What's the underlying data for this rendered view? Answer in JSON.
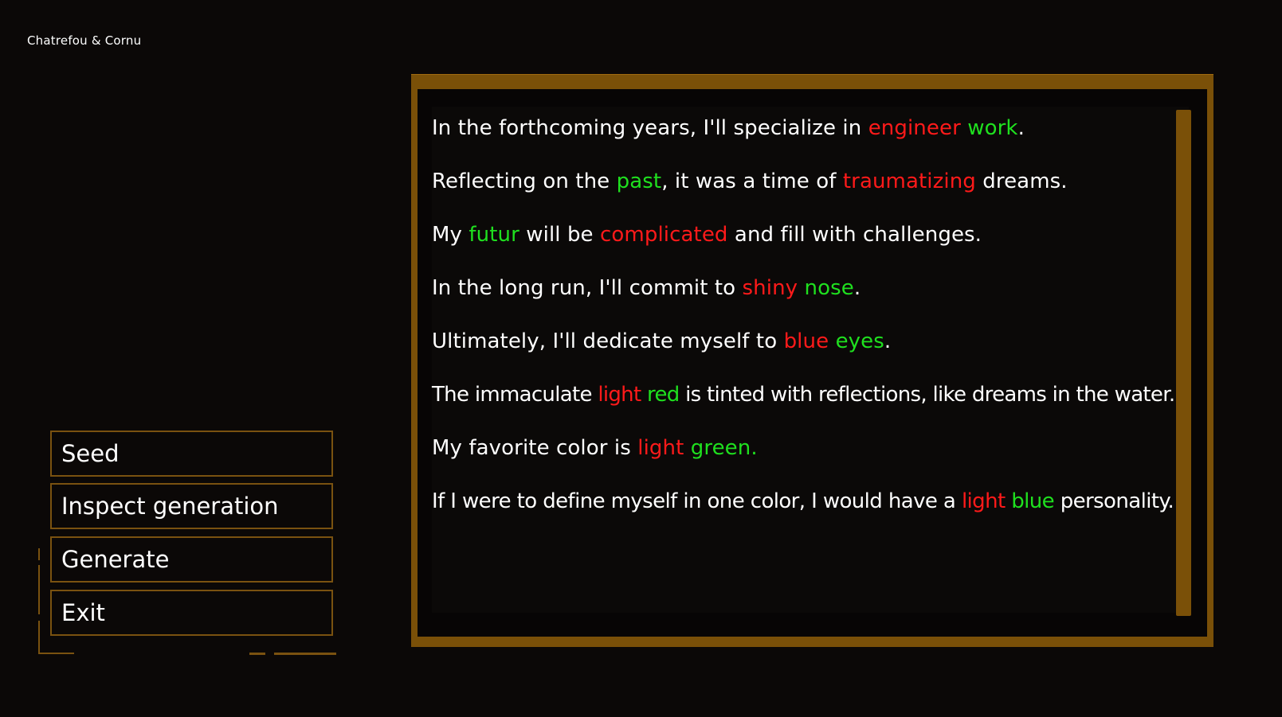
{
  "studio": "Chatrefou & Cornu",
  "menu": {
    "seed": "Seed",
    "inspect": "Inspect generation",
    "generate": "Generate",
    "exit": "Exit"
  },
  "colors": {
    "accent": "#7a5008",
    "highlight_red": "#ff1a1a",
    "highlight_green": "#1fe01f",
    "background": "#0b0807"
  },
  "lines": [
    {
      "pre": "In the forthcoming years, I'll specialize in ",
      "red": "engineer",
      "mid": " ",
      "green": "work",
      "post": "."
    },
    {
      "pre": "Reflecting on the ",
      "green": "past",
      "mid": ", it was a time of ",
      "red": "traumatizing",
      "post": " dreams."
    },
    {
      "pre": "My ",
      "green": "futur",
      "mid": " will be ",
      "red": "complicated",
      "post": " and fill with challenges."
    },
    {
      "pre": "In the long run, I'll commit to ",
      "red": "shiny",
      "mid": " ",
      "green": "nose",
      "post": "."
    },
    {
      "pre": "Ultimately, I'll dedicate myself to ",
      "red": "blue",
      "mid": " ",
      "green": "eyes",
      "post": "."
    },
    {
      "pre": "The immaculate ",
      "red": "light",
      "mid": " ",
      "green": "red",
      "post": " is tinted with reflections, like dreams in the water."
    },
    {
      "pre": "My favorite color is ",
      "red": "light",
      "mid": " ",
      "green": "green.",
      "post": ""
    },
    {
      "pre": "If I were to define myself in one color, I would have a ",
      "red": "light",
      "mid": " ",
      "green": "blue",
      "post": " personality."
    }
  ]
}
